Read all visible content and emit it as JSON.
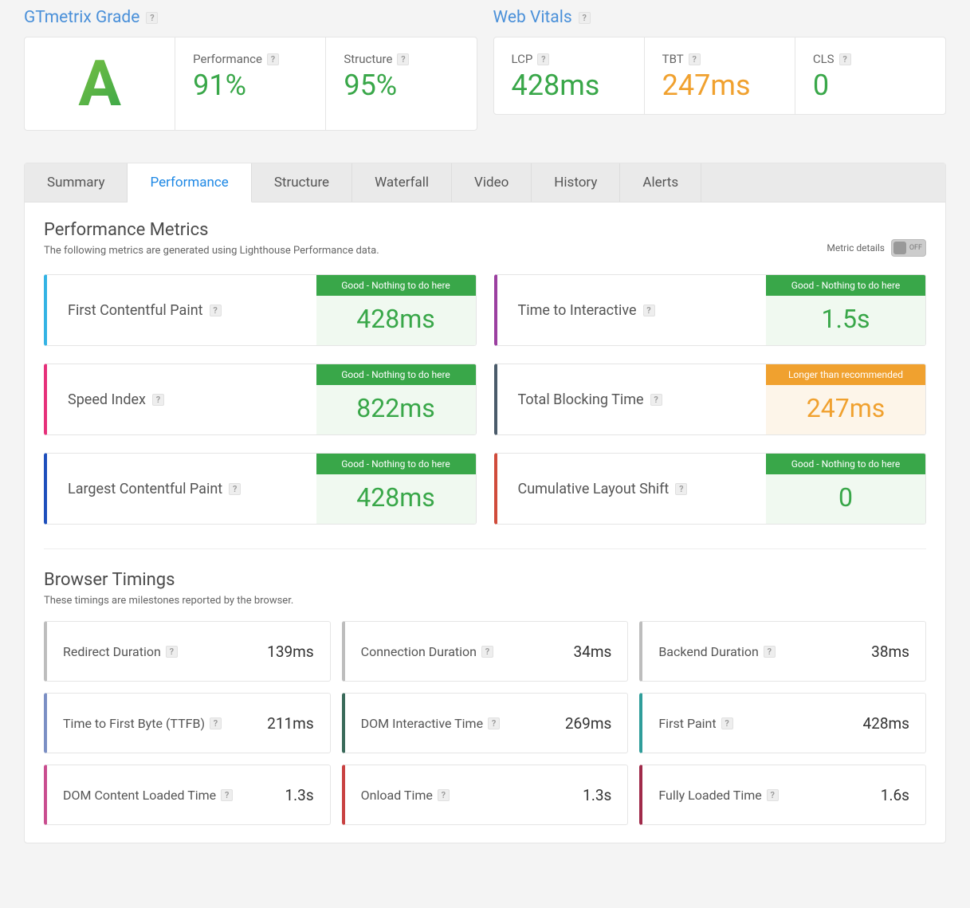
{
  "grade_section": {
    "title": "GTmetrix Grade",
    "letter": "A",
    "performance_label": "Performance",
    "performance_value": "91%",
    "structure_label": "Structure",
    "structure_value": "95%"
  },
  "vitals_section": {
    "title": "Web Vitals",
    "lcp_label": "LCP",
    "lcp_value": "428ms",
    "tbt_label": "TBT",
    "tbt_value": "247ms",
    "cls_label": "CLS",
    "cls_value": "0"
  },
  "tabs": {
    "summary": "Summary",
    "performance": "Performance",
    "structure": "Structure",
    "waterfall": "Waterfall",
    "video": "Video",
    "history": "History",
    "alerts": "Alerts"
  },
  "perf_metrics": {
    "heading": "Performance Metrics",
    "sub": "The following metrics are generated using Lighthouse Performance data.",
    "toggle_label": "Metric details",
    "toggle_value": "OFF",
    "status_good": "Good - Nothing to do here",
    "status_warn": "Longer than recommended",
    "items": [
      {
        "name": "First Contentful Paint",
        "value": "428ms",
        "status": "good",
        "accent": "#34b3e4"
      },
      {
        "name": "Time to Interactive",
        "value": "1.5s",
        "status": "good",
        "accent": "#9b3fa0"
      },
      {
        "name": "Speed Index",
        "value": "822ms",
        "status": "good",
        "accent": "#e6307a"
      },
      {
        "name": "Total Blocking Time",
        "value": "247ms",
        "status": "warn",
        "accent": "#4a5b6a"
      },
      {
        "name": "Largest Contentful Paint",
        "value": "428ms",
        "status": "good",
        "accent": "#1e4fbc"
      },
      {
        "name": "Cumulative Layout Shift",
        "value": "0",
        "status": "good",
        "accent": "#d04b3b"
      }
    ]
  },
  "browser_timings": {
    "heading": "Browser Timings",
    "sub": "These timings are milestones reported by the browser.",
    "items": [
      {
        "name": "Redirect Duration",
        "value": "139ms",
        "accent": "#bdbdbd"
      },
      {
        "name": "Connection Duration",
        "value": "34ms",
        "accent": "#bdbdbd"
      },
      {
        "name": "Backend Duration",
        "value": "38ms",
        "accent": "#bdbdbd"
      },
      {
        "name": "Time to First Byte (TTFB)",
        "value": "211ms",
        "accent": "#7b8fc4"
      },
      {
        "name": "DOM Interactive Time",
        "value": "269ms",
        "accent": "#3a6a5a"
      },
      {
        "name": "First Paint",
        "value": "428ms",
        "accent": "#2f9d9a"
      },
      {
        "name": "DOM Content Loaded Time",
        "value": "1.3s",
        "accent": "#c94d8f"
      },
      {
        "name": "Onload Time",
        "value": "1.3s",
        "accent": "#c94242"
      },
      {
        "name": "Fully Loaded Time",
        "value": "1.6s",
        "accent": "#a02a4a"
      }
    ]
  }
}
